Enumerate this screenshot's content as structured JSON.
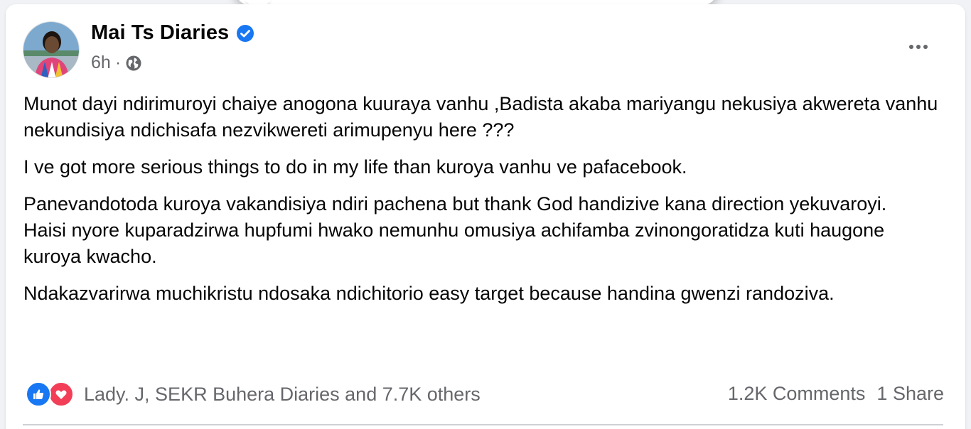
{
  "post": {
    "author": "Mai Ts Diaries",
    "verified": true,
    "timestamp": "6h",
    "separator": "·",
    "audience_icon": "globe-icon",
    "more_icon": "more-options-icon",
    "paragraphs": [
      "Munot dayi ndirimuroyi chaiye anogona kuuraya vanhu ,Badista akaba mariyangu nekusiya akwereta vanhu nekundisiya ndichisafa nezvikwereti arimupenyu here ???",
      "I ve got more serious things to do in my life than kuroya vanhu ve pafacebook.",
      "Panevandotoda kuroya vakandisiya ndiri pachena but thank God handizive kana direction yekuvaroyi.",
      "Haisi nyore kuparadzirwa hupfumi hwako nemunhu omusiya achifamba zvinongoratidza kuti haugone kuroya kwacho.",
      "Ndakazvarirwa muchikristu ndosaka ndichitorio easy target because handina gwenzi randoziva."
    ]
  },
  "reactions": {
    "icons": [
      "like-icon",
      "love-icon"
    ],
    "summary": "Lady. J, SEKR Buhera Diaries and 7.7K others"
  },
  "stats": {
    "comments": "1.2K Comments",
    "shares": "1 Share"
  },
  "colors": {
    "verified_blue": "#1877f2",
    "like_blue": "#1877f2",
    "love_red": "#f33e58",
    "secondary_text": "#65676b"
  }
}
